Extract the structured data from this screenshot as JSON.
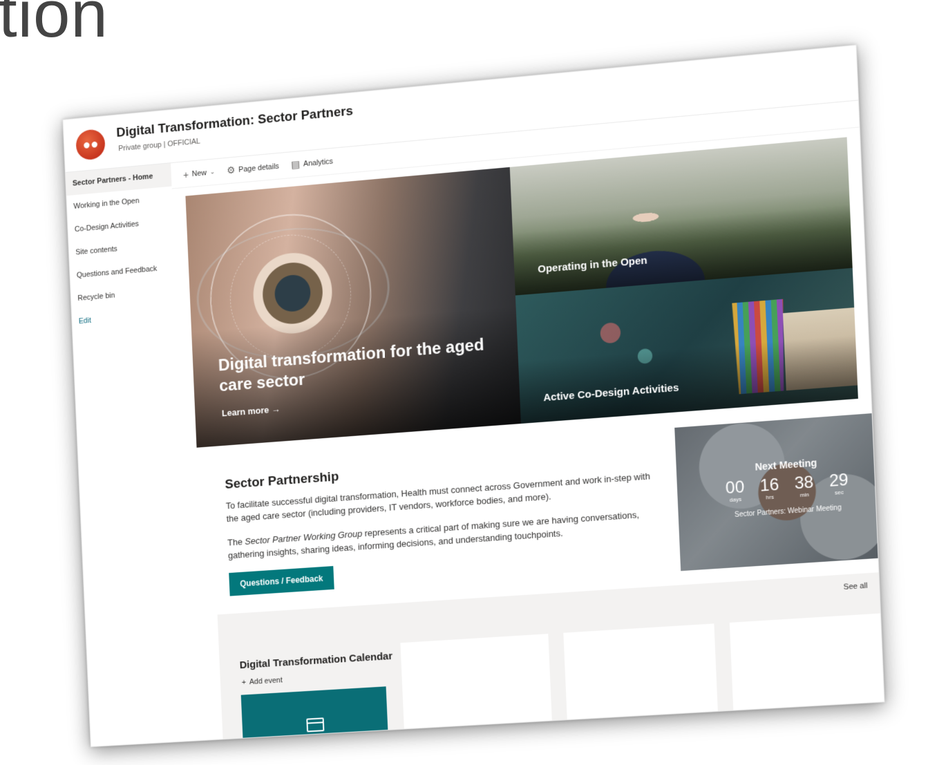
{
  "background_heading": "tion",
  "site": {
    "title": "Digital Transformation: Sector Partners",
    "subtitle": "Private group | OFFICIAL",
    "logo_icon": "group-people-icon",
    "accent": "#d6402a"
  },
  "nav": {
    "items": [
      {
        "label": "Sector Partners - Home"
      },
      {
        "label": "Working in the Open"
      },
      {
        "label": "Co-Design Activities"
      },
      {
        "label": "Site contents"
      },
      {
        "label": "Questions and Feedback"
      },
      {
        "label": "Recycle bin"
      }
    ],
    "edit_label": "Edit"
  },
  "commandbar": {
    "new_label": "New",
    "page_details_label": "Page details",
    "analytics_label": "Analytics"
  },
  "hero": {
    "main_title": "Digital transformation for the aged care sector",
    "main_link": "Learn more →",
    "top_tile_label": "Operating in the Open",
    "bottom_tile_label": "Active Co-Design Activities"
  },
  "partnership": {
    "heading": "Sector Partnership",
    "para1": "To facilitate successful digital transformation, Health must connect across Government and work in-step with the aged care sector (including providers, IT vendors, workforce bodies, and more).",
    "para2_prefix": "The ",
    "para2_em": "Sector Partner Working Group",
    "para2_suffix": " represents a critical part of making sure we are having conversations, gathering insights, sharing ideas, informing decisions, and understanding touchpoints.",
    "button_label": "Questions / Feedback",
    "button_color": "#03787c"
  },
  "countdown": {
    "title": "Next Meeting",
    "days": "00",
    "days_unit": "days",
    "hrs": "16",
    "hrs_unit": "hrs",
    "min": "38",
    "min_unit": "min",
    "sec": "29",
    "sec_unit": "sec",
    "event": "Sector Partners: Webinar Meeting"
  },
  "calendar": {
    "title": "Digital Transformation Calendar",
    "add_label": "Add event",
    "see_all": "See all",
    "tile_color": "#0a6e76"
  }
}
